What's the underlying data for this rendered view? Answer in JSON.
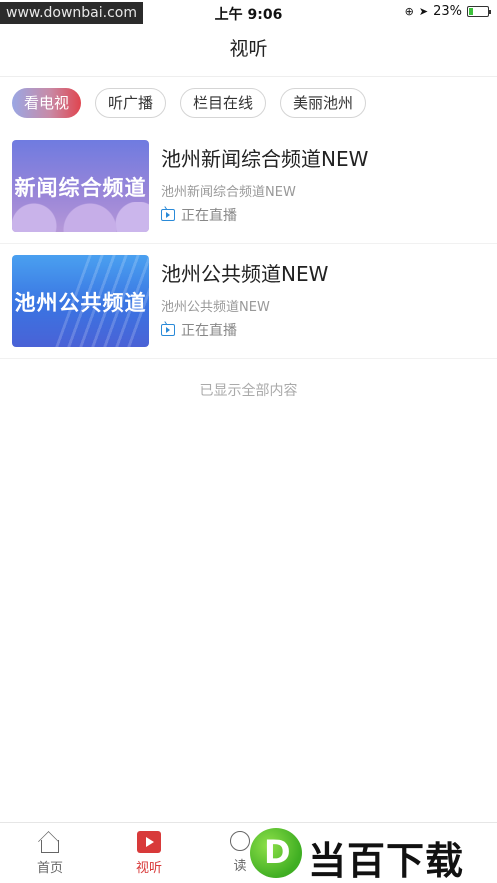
{
  "status_bar": {
    "watermark": "www.downbai.com",
    "time": "上午 9:06",
    "battery_percent": "23%",
    "battery_level": 0.23
  },
  "header": {
    "title": "视听"
  },
  "tabs": [
    {
      "label": "看电视",
      "active": true
    },
    {
      "label": "听广播",
      "active": false
    },
    {
      "label": "栏目在线",
      "active": false
    },
    {
      "label": "美丽池州",
      "active": false
    }
  ],
  "channels": [
    {
      "thumb_text": "新闻综合频道",
      "title": "池州新闻综合频道NEW",
      "subtitle": "池州新闻综合频道NEW",
      "status": "正在直播"
    },
    {
      "thumb_text": "池州公共频道",
      "title": "池州公共频道NEW",
      "subtitle": "池州公共频道NEW",
      "status": "正在直播"
    }
  ],
  "list_end_text": "已显示全部内容",
  "tabbar": [
    {
      "label": "首页",
      "icon": "home-icon",
      "active": false
    },
    {
      "label": "视听",
      "icon": "video-icon",
      "active": true
    },
    {
      "label": "读",
      "icon": "read-icon",
      "active": false
    }
  ],
  "brand": {
    "letter": "D",
    "text": "当百下载"
  },
  "colors": {
    "accent_red": "#d83a3a",
    "live_icon_blue": "#2a8ad8",
    "battery_green": "#3cc13c"
  }
}
